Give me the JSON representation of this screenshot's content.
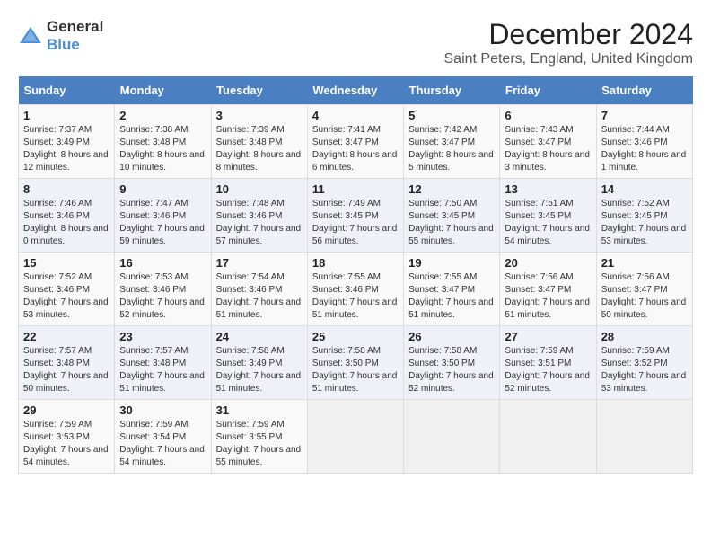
{
  "logo": {
    "text_general": "General",
    "text_blue": "Blue"
  },
  "title": "December 2024",
  "subtitle": "Saint Peters, England, United Kingdom",
  "days_of_week": [
    "Sunday",
    "Monday",
    "Tuesday",
    "Wednesday",
    "Thursday",
    "Friday",
    "Saturday"
  ],
  "weeks": [
    [
      {
        "day": "1",
        "sunrise": "7:37 AM",
        "sunset": "3:49 PM",
        "daylight": "8 hours and 12 minutes."
      },
      {
        "day": "2",
        "sunrise": "7:38 AM",
        "sunset": "3:48 PM",
        "daylight": "8 hours and 10 minutes."
      },
      {
        "day": "3",
        "sunrise": "7:39 AM",
        "sunset": "3:48 PM",
        "daylight": "8 hours and 8 minutes."
      },
      {
        "day": "4",
        "sunrise": "7:41 AM",
        "sunset": "3:47 PM",
        "daylight": "8 hours and 6 minutes."
      },
      {
        "day": "5",
        "sunrise": "7:42 AM",
        "sunset": "3:47 PM",
        "daylight": "8 hours and 5 minutes."
      },
      {
        "day": "6",
        "sunrise": "7:43 AM",
        "sunset": "3:47 PM",
        "daylight": "8 hours and 3 minutes."
      },
      {
        "day": "7",
        "sunrise": "7:44 AM",
        "sunset": "3:46 PM",
        "daylight": "8 hours and 1 minute."
      }
    ],
    [
      {
        "day": "8",
        "sunrise": "7:46 AM",
        "sunset": "3:46 PM",
        "daylight": "8 hours and 0 minutes."
      },
      {
        "day": "9",
        "sunrise": "7:47 AM",
        "sunset": "3:46 PM",
        "daylight": "7 hours and 59 minutes."
      },
      {
        "day": "10",
        "sunrise": "7:48 AM",
        "sunset": "3:46 PM",
        "daylight": "7 hours and 57 minutes."
      },
      {
        "day": "11",
        "sunrise": "7:49 AM",
        "sunset": "3:45 PM",
        "daylight": "7 hours and 56 minutes."
      },
      {
        "day": "12",
        "sunrise": "7:50 AM",
        "sunset": "3:45 PM",
        "daylight": "7 hours and 55 minutes."
      },
      {
        "day": "13",
        "sunrise": "7:51 AM",
        "sunset": "3:45 PM",
        "daylight": "7 hours and 54 minutes."
      },
      {
        "day": "14",
        "sunrise": "7:52 AM",
        "sunset": "3:45 PM",
        "daylight": "7 hours and 53 minutes."
      }
    ],
    [
      {
        "day": "15",
        "sunrise": "7:52 AM",
        "sunset": "3:46 PM",
        "daylight": "7 hours and 53 minutes."
      },
      {
        "day": "16",
        "sunrise": "7:53 AM",
        "sunset": "3:46 PM",
        "daylight": "7 hours and 52 minutes."
      },
      {
        "day": "17",
        "sunrise": "7:54 AM",
        "sunset": "3:46 PM",
        "daylight": "7 hours and 51 minutes."
      },
      {
        "day": "18",
        "sunrise": "7:55 AM",
        "sunset": "3:46 PM",
        "daylight": "7 hours and 51 minutes."
      },
      {
        "day": "19",
        "sunrise": "7:55 AM",
        "sunset": "3:47 PM",
        "daylight": "7 hours and 51 minutes."
      },
      {
        "day": "20",
        "sunrise": "7:56 AM",
        "sunset": "3:47 PM",
        "daylight": "7 hours and 51 minutes."
      },
      {
        "day": "21",
        "sunrise": "7:56 AM",
        "sunset": "3:47 PM",
        "daylight": "7 hours and 50 minutes."
      }
    ],
    [
      {
        "day": "22",
        "sunrise": "7:57 AM",
        "sunset": "3:48 PM",
        "daylight": "7 hours and 50 minutes."
      },
      {
        "day": "23",
        "sunrise": "7:57 AM",
        "sunset": "3:48 PM",
        "daylight": "7 hours and 51 minutes."
      },
      {
        "day": "24",
        "sunrise": "7:58 AM",
        "sunset": "3:49 PM",
        "daylight": "7 hours and 51 minutes."
      },
      {
        "day": "25",
        "sunrise": "7:58 AM",
        "sunset": "3:50 PM",
        "daylight": "7 hours and 51 minutes."
      },
      {
        "day": "26",
        "sunrise": "7:58 AM",
        "sunset": "3:50 PM",
        "daylight": "7 hours and 52 minutes."
      },
      {
        "day": "27",
        "sunrise": "7:59 AM",
        "sunset": "3:51 PM",
        "daylight": "7 hours and 52 minutes."
      },
      {
        "day": "28",
        "sunrise": "7:59 AM",
        "sunset": "3:52 PM",
        "daylight": "7 hours and 53 minutes."
      }
    ],
    [
      {
        "day": "29",
        "sunrise": "7:59 AM",
        "sunset": "3:53 PM",
        "daylight": "7 hours and 54 minutes."
      },
      {
        "day": "30",
        "sunrise": "7:59 AM",
        "sunset": "3:54 PM",
        "daylight": "7 hours and 54 minutes."
      },
      {
        "day": "31",
        "sunrise": "7:59 AM",
        "sunset": "3:55 PM",
        "daylight": "7 hours and 55 minutes."
      },
      null,
      null,
      null,
      null
    ]
  ]
}
